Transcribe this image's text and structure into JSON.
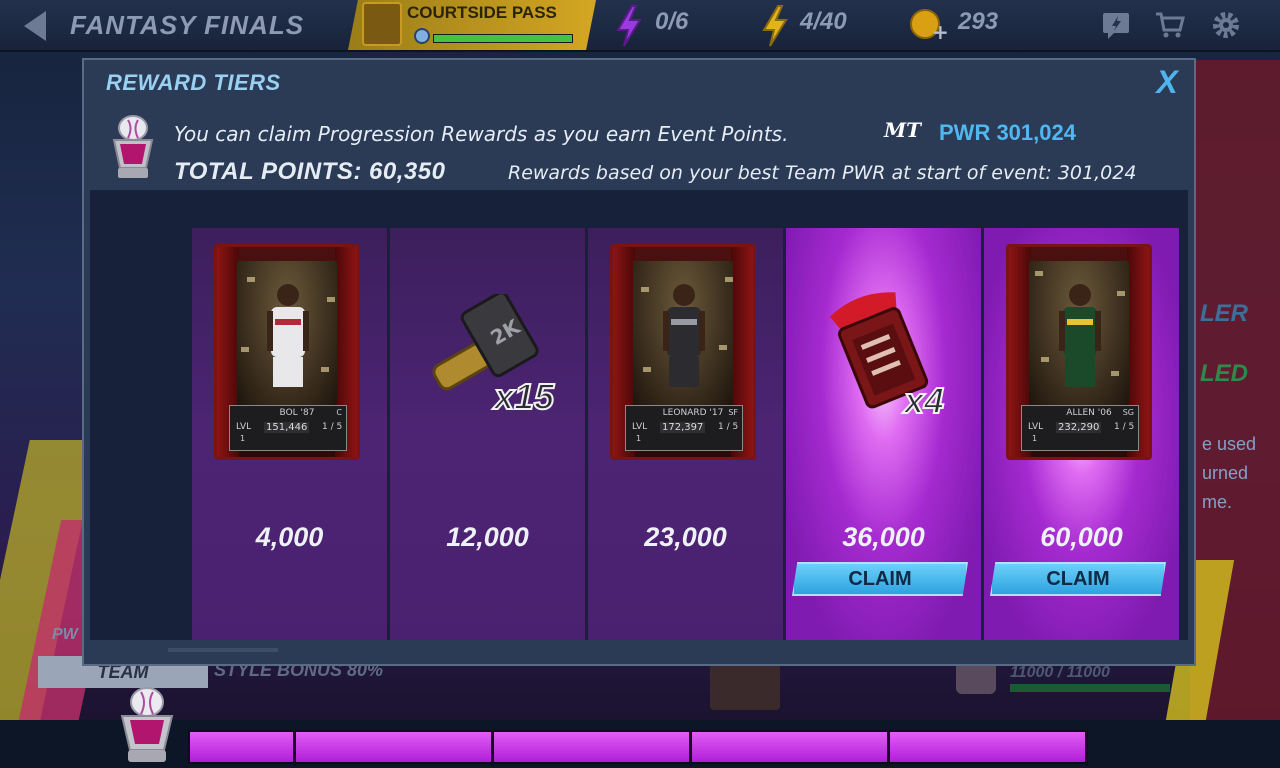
{
  "topbar": {
    "title": "FANTASY FINALS",
    "pass_label": "COURTSIDE PASS",
    "pass_progress": 1.0,
    "purple_energy": "0/6",
    "yellow_energy": "4/40",
    "coins": "293",
    "icons": [
      "back-arrow-icon",
      "purple-bolt-icon",
      "yellow-bolt-icon",
      "coin-icon",
      "news-icon",
      "cart-icon",
      "gear-icon"
    ]
  },
  "background": {
    "pw": "PW",
    "team_button": "TEAM",
    "style_bonus": "STYLE BONUS 80%",
    "right_text_1": "LER",
    "right_text_2": "LED",
    "right_text_3": "e used",
    "right_text_4": "urned",
    "right_text_5": "me.",
    "score": "11000 / 11000"
  },
  "modal": {
    "title": "REWARD TIERS",
    "close_label": "X",
    "info_text": "You can claim Progression Rewards as you earn Event Points.",
    "mt_logo": "MT",
    "pwr": "PWR 301,024",
    "total_points": "TOTAL POINTS: 60,350",
    "rewards_based": "Rewards based on your best Team PWR at start of event: 301,024"
  },
  "tiers": [
    {
      "points": "4,000",
      "type": "player-card",
      "card_name": "BOL '87",
      "position": "C",
      "lvl": "LVL",
      "lvl_num": "1",
      "ovr": "151,446",
      "stars": "1 / 5",
      "claimable": false
    },
    {
      "points": "12,000",
      "type": "key",
      "multiplier": "x15",
      "claimable": false
    },
    {
      "points": "23,000",
      "type": "player-card",
      "card_name": "LEONARD '17",
      "position": "SF",
      "lvl": "LVL",
      "lvl_num": "1",
      "ovr": "172,397",
      "stars": "1 / 5",
      "claimable": false
    },
    {
      "points": "36,000",
      "type": "playbook",
      "multiplier": "x4",
      "claimable": true,
      "claim_label": "CLAIM"
    },
    {
      "points": "60,000",
      "type": "player-card",
      "card_name": "ALLEN '06",
      "position": "SG",
      "lvl": "LVL",
      "lvl_num": "1",
      "ovr": "232,290",
      "stars": "1 / 5",
      "claimable": true,
      "claim_label": "CLAIM"
    }
  ],
  "progress": {
    "fraction": 1.0,
    "color": "#c43ae6"
  },
  "colors": {
    "accent_blue": "#4fb8f0",
    "claim_button": "#3fb0ea",
    "tier_purple": "#4d2474",
    "claim_glow": "#e06cf2"
  }
}
